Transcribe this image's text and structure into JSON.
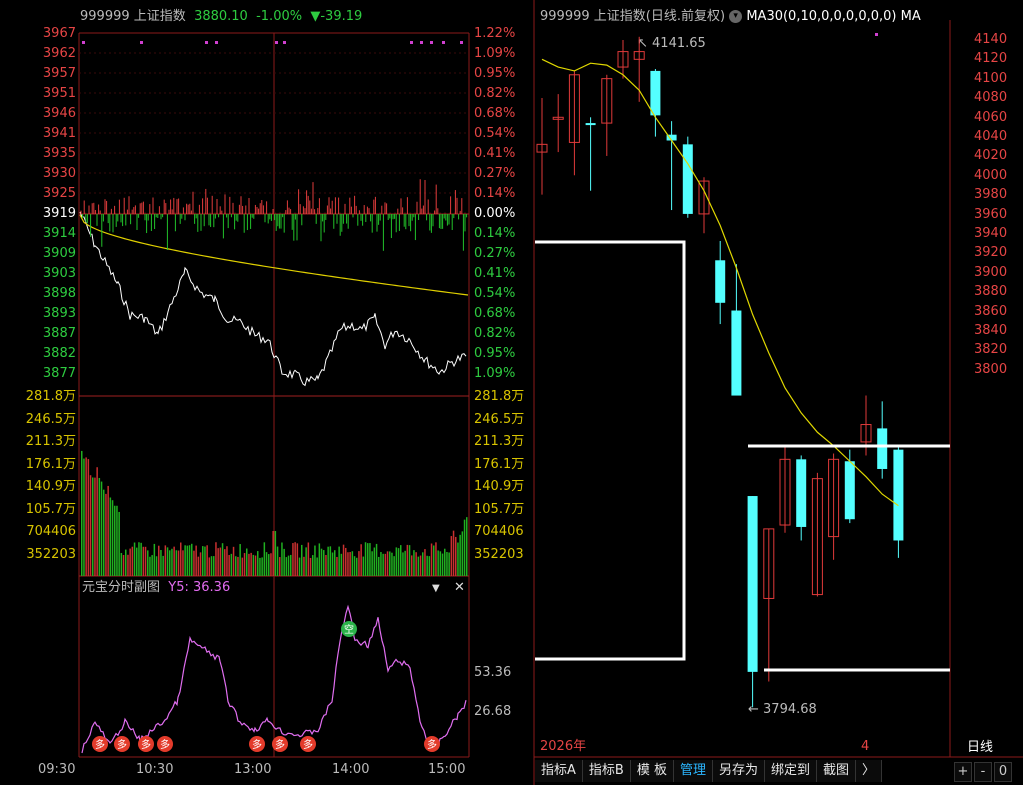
{
  "left_header": {
    "code": "999999",
    "name": "上证指数",
    "price": "3880.10",
    "pct": "-1.00%",
    "change": "▼-39.19"
  },
  "right_header": {
    "title": "999999 上证指数(日线.前复权)",
    "dropdown_icon": "chevron-down-icon",
    "ma": "MA30(0,10,0,0,0,0,0,0)",
    "ma_trunc": "MA"
  },
  "price_axis": {
    "left": [
      "3967",
      "3962",
      "3957",
      "3951",
      "3946",
      "3941",
      "3935",
      "3930",
      "3925",
      "3919",
      "3914",
      "3909",
      "3903",
      "3898",
      "3893",
      "3887",
      "3882",
      "3877"
    ],
    "right": [
      "1.22%",
      "1.09%",
      "0.95%",
      "0.82%",
      "0.68%",
      "0.54%",
      "0.41%",
      "0.27%",
      "0.14%",
      "0.00%",
      "0.14%",
      "0.27%",
      "0.41%",
      "0.54%",
      "0.68%",
      "0.82%",
      "0.95%",
      "1.09%"
    ]
  },
  "volume_axis": [
    "281.8万",
    "246.5万",
    "211.3万",
    "176.1万",
    "140.9万",
    "105.7万",
    "704406",
    "352203"
  ],
  "sub_panel": {
    "title": "元宝分时副图",
    "indicator": "Y5: 36.36",
    "levels": [
      "53.36",
      "26.68"
    ],
    "signal_duo": "多",
    "signal_kong": "空",
    "dropdown_icon": "triangle-down-icon",
    "close_icon": "close-icon"
  },
  "time_axis": [
    "09:30",
    "10:30",
    "13:00",
    "14:00",
    "15:00"
  ],
  "kline": {
    "axis": [
      "4140",
      "4120",
      "4100",
      "4080",
      "4060",
      "4040",
      "4020",
      "4000",
      "3980",
      "3960",
      "3940",
      "3920",
      "3900",
      "3880",
      "3860",
      "3840",
      "3820",
      "3800"
    ],
    "high_label": "4141.65",
    "low_label": "3794.68",
    "date_left": "2026年",
    "date_mid": "4",
    "period": "日线",
    "candles": [
      {
        "o": 4082,
        "c": 4086,
        "h": 4110,
        "l": 4060
      },
      {
        "o": 4099,
        "c": 4100,
        "h": 4112,
        "l": 4082
      },
      {
        "o": 4087,
        "c": 4122,
        "h": 4124,
        "l": 4070
      },
      {
        "o": 4097,
        "c": 4096,
        "h": 4100,
        "l": 4062
      },
      {
        "o": 4097,
        "c": 4120,
        "h": 4122,
        "l": 4080
      },
      {
        "o": 4126,
        "c": 4134,
        "h": 4140,
        "l": 4120
      },
      {
        "o": 4130,
        "c": 4134,
        "h": 4141.65,
        "l": 4108
      },
      {
        "o": 4124,
        "c": 4101,
        "h": 4125,
        "l": 4090
      },
      {
        "o": 4091,
        "c": 4088,
        "h": 4098,
        "l": 4052
      },
      {
        "o": 4086,
        "c": 4050,
        "h": 4090,
        "l": 4048
      },
      {
        "o": 4050,
        "c": 4067,
        "h": 4069,
        "l": 4040
      },
      {
        "o": 4026,
        "c": 4004,
        "h": 4036,
        "l": 3993
      },
      {
        "o": 4000,
        "c": 3956,
        "h": 4024,
        "l": 3956
      },
      {
        "o": 3904,
        "c": 3813,
        "h": 3904,
        "l": 3794.68
      },
      {
        "o": 3851,
        "c": 3887,
        "h": 3887,
        "l": 3808
      },
      {
        "o": 3889,
        "c": 3923,
        "h": 3930,
        "l": 3885
      },
      {
        "o": 3923,
        "c": 3888,
        "h": 3925,
        "l": 3881
      },
      {
        "o": 3853,
        "c": 3913,
        "h": 3916,
        "l": 3852
      },
      {
        "o": 3883,
        "c": 3923,
        "h": 3926,
        "l": 3871
      },
      {
        "o": 3922,
        "c": 3892,
        "h": 3928,
        "l": 3890
      },
      {
        "o": 3932,
        "c": 3941,
        "h": 3956,
        "l": 3925
      },
      {
        "o": 3939,
        "c": 3918,
        "h": 3953,
        "l": 3913
      },
      {
        "o": 3928,
        "c": 3881,
        "h": 3930,
        "l": 3872
      }
    ],
    "ma30": [
      4130,
      4126,
      4124,
      4128,
      4127,
      4122,
      4114,
      4100,
      4088,
      4076,
      4062,
      4044,
      4022,
      3998,
      3978,
      3960,
      3947,
      3937,
      3930,
      3922,
      3914,
      3905,
      3899
    ]
  },
  "tabs": [
    "指标A",
    "指标B",
    "模 板",
    "管理",
    "另存为",
    "绑定到",
    "截图",
    "〉"
  ],
  "corner_buttons": [
    "+",
    "-",
    "0"
  ]
}
